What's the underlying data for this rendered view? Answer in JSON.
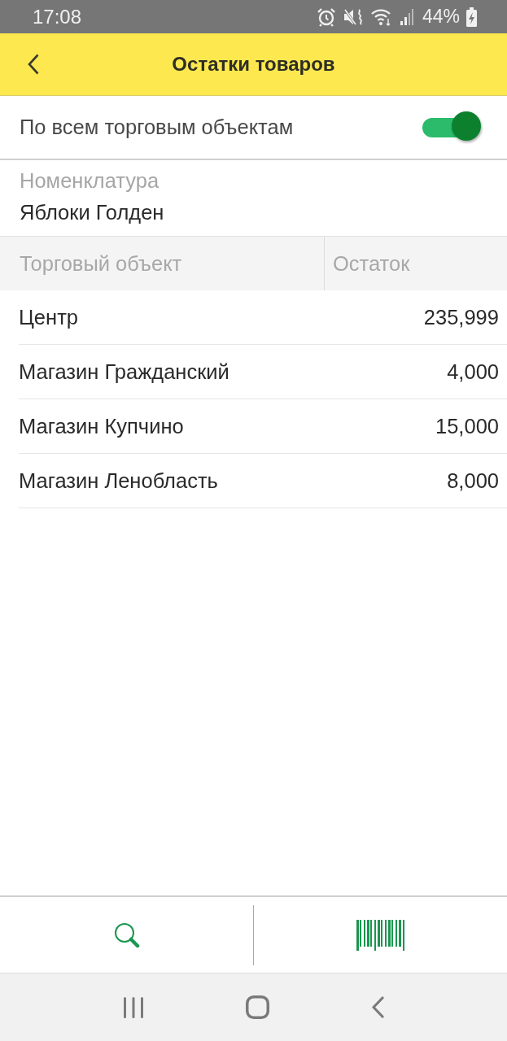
{
  "status_bar": {
    "time": "17:08",
    "battery": "44%"
  },
  "header": {
    "title": "Остатки товаров"
  },
  "filter": {
    "label": "По всем торговым объектам",
    "on": true
  },
  "field": {
    "label": "Номенклатура",
    "value": "Яблоки Голден"
  },
  "table": {
    "columns": [
      "Торговый объект",
      "Остаток"
    ],
    "rows": [
      {
        "cells": [
          "Центр",
          "235,999"
        ]
      },
      {
        "cells": [
          "Магазин Гражданский",
          "4,000"
        ]
      },
      {
        "cells": [
          "Магазин Купчино",
          "15,000"
        ]
      },
      {
        "cells": [
          "Магазин Ленобласть",
          "8,000"
        ]
      }
    ]
  }
}
